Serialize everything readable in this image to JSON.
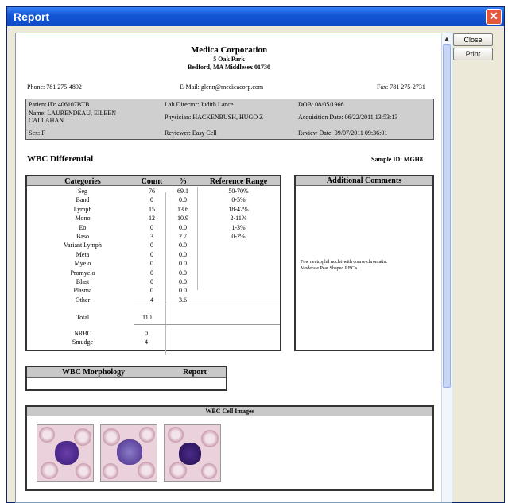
{
  "window": {
    "title": "Report",
    "close_glyph": "✕"
  },
  "buttons": {
    "close": "Close",
    "print": "Print"
  },
  "header": {
    "org": "Medica Corporation",
    "address1": "5 Oak Park",
    "address2": "Bedford, MA Middlesex 01730",
    "phone": "Phone: 781 275-4892",
    "email": "E-Mail: glenn@medicacorp.com",
    "fax": "Fax: 781 275-2731"
  },
  "patient": {
    "id": "Patient ID: 406107BTB",
    "name": "Name: LAURENDEAU, EILEEN CALLAHAN",
    "sex": "Sex: F",
    "lab_director": "Lab Director: Judith Lance",
    "physician": "Physician: HACKENBUSH, HUGO Z",
    "reviewer": "Reviewer: Easy Cell",
    "dob": "DOB: 08/05/1966",
    "acq_date": "Acquisition Date: 06/22/2011 13:53:13",
    "review_date": "Review Date: 09/07/2011 09:36:01"
  },
  "section_title": "WBC Differential",
  "sample_id": "Sample ID: MGH8",
  "table": {
    "headers": {
      "category": "Categories",
      "count": "Count",
      "pct": "%",
      "ref": "Reference Range"
    },
    "rows": [
      {
        "category": "Seg",
        "count": "76",
        "pct": "69.1",
        "ref": "50-70%"
      },
      {
        "category": "Band",
        "count": "0",
        "pct": "0.0",
        "ref": "0-5%"
      },
      {
        "category": "Lymph",
        "count": "15",
        "pct": "13.6",
        "ref": "18-42%"
      },
      {
        "category": "Mono",
        "count": "12",
        "pct": "10.9",
        "ref": "2-11%"
      },
      {
        "category": "Eo",
        "count": "0",
        "pct": "0.0",
        "ref": "1-3%"
      },
      {
        "category": "Baso",
        "count": "3",
        "pct": "2.7",
        "ref": "0-2%"
      },
      {
        "category": "Variant Lymph",
        "count": "0",
        "pct": "0.0",
        "ref": ""
      },
      {
        "category": "Meta",
        "count": "0",
        "pct": "0.0",
        "ref": ""
      },
      {
        "category": "Myelo",
        "count": "0",
        "pct": "0.0",
        "ref": ""
      },
      {
        "category": "Promyelo",
        "count": "0",
        "pct": "0.0",
        "ref": ""
      },
      {
        "category": "Blast",
        "count": "0",
        "pct": "0.0",
        "ref": ""
      },
      {
        "category": "Plasma",
        "count": "0",
        "pct": "0.0",
        "ref": ""
      },
      {
        "category": "Other",
        "count": "4",
        "pct": "3.6",
        "ref": ""
      }
    ],
    "total_label": "Total",
    "total": "110",
    "nrbc_label": "NRBC",
    "nrbc": "0",
    "smudge_label": "Smudge",
    "smudge": "4"
  },
  "comments": {
    "title": "Additional Comments",
    "text1": "Few neutrophil nuclei with coarse chromatin.",
    "text2": "Moderate Pear Shaped RBC's"
  },
  "morphology": {
    "title": "WBC Morphology",
    "report": "Report"
  },
  "images": {
    "title": "WBC Cell Images"
  }
}
